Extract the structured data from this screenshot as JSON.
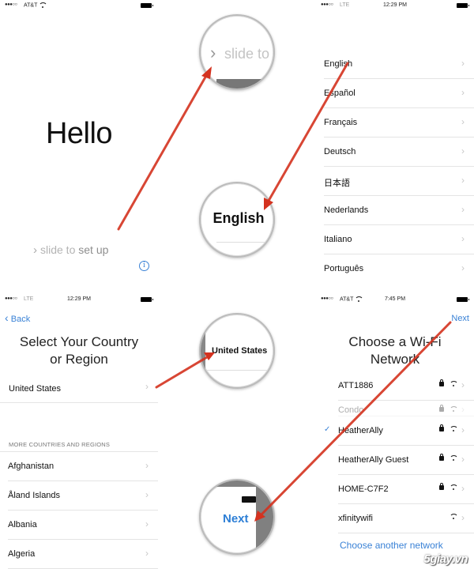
{
  "screens": {
    "hello": {
      "status": {
        "carrier": "AT&T",
        "signal_dots": "●●●○○"
      },
      "greeting": "Hello",
      "slide_prefix": "slide to ",
      "slide_suffix": "set up",
      "info_glyph": "i",
      "icons": {
        "chevron": "chevron-right-icon",
        "info": "info-icon"
      }
    },
    "language": {
      "status": {
        "carrier": "LTE",
        "time": "12:29 PM",
        "signal_dots": "●●●○○"
      },
      "items": [
        "English",
        "Español",
        "Français",
        "Deutsch",
        "日本語",
        "Nederlands",
        "Italiano",
        "Português"
      ]
    },
    "country": {
      "status": {
        "carrier": "LTE",
        "time": "12:29 PM",
        "signal_dots": "●●●○○"
      },
      "back_label": "Back",
      "title_line1": "Select Your Country",
      "title_line2": "or Region",
      "selected": "United States",
      "section_header": "MORE COUNTRIES AND REGIONS",
      "items": [
        "Afghanistan",
        "Åland Islands",
        "Albania",
        "Algeria"
      ]
    },
    "wifi": {
      "status": {
        "carrier": "AT&T",
        "time": "7:45 PM",
        "signal_dots": "●●●○○"
      },
      "next_label": "Next",
      "title_line1": "Choose a Wi-Fi",
      "title_line2": "Network",
      "networks": [
        {
          "name": "ATT1886",
          "locked": true,
          "selected": false,
          "faded": false
        },
        {
          "name": "Condo",
          "locked": true,
          "selected": false,
          "faded": true
        },
        {
          "name": "HeatherAlly",
          "locked": true,
          "selected": true,
          "faded": false
        },
        {
          "name": "HeatherAlly Guest",
          "locked": true,
          "selected": false,
          "faded": false
        },
        {
          "name": "HOME-C7F2",
          "locked": true,
          "selected": false,
          "faded": false
        },
        {
          "name": "xfinitywifi",
          "locked": false,
          "selected": false,
          "faded": false
        }
      ],
      "other_label": "Choose another network"
    }
  },
  "magnifiers": {
    "slide": "slide to",
    "english": "English",
    "country": "United States",
    "next": "Next"
  },
  "glyphs": {
    "chevron": "›",
    "check": "✓"
  },
  "watermark": "5giay.vn",
  "colors": {
    "accent": "#3a82d6",
    "arrow": "#d4321f"
  }
}
